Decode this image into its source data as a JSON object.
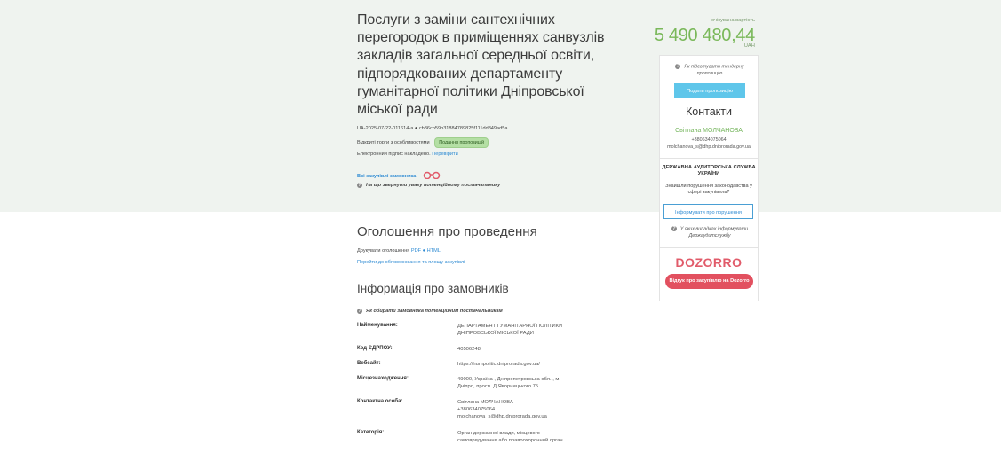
{
  "tender": {
    "title": "Послуги з заміни сантехнічних перегородок в приміщеннях санвузлів закладів загальної середньої освіти, підпорядкованих департаменту гуманітарної політики Дніпровської міської ради",
    "id_line": "UA-2025-07-22-011614-a ● cb86cb59b31884789825f111dd849ad5a",
    "status_prefix": "Відкриті торги з особливостями",
    "status_badge": "Подання пропозицій",
    "signature_text": "Електронний підпис накладено.",
    "signature_link": "Перевірити",
    "buyer_purchases_link": "Всі закупівлі замовника",
    "hint_attention": "На що звернути увагу потенційному постачальнику"
  },
  "sidebar": {
    "amount_label": "очікувана вартість",
    "amount": "5 490 480,44",
    "currency": "UAH",
    "prepare_hint": "Як підготувати тендерну пропозицію",
    "submit_button": "Подати пропозицію",
    "contacts_title": "Контакти",
    "contact_name": "Світлана МОЛЧАНОВА",
    "contact_phone": "+380634075064",
    "contact_email": "molchanova_s@dhp.dniprorada.gov.ua",
    "audit_title": "ДЕРЖАВНА АУДИТОРСЬКА СЛУЖБА УКРАЇНИ",
    "audit_text": "Знайшли порушення законодавства у сфері закупівель?",
    "report_button": "Інформувати про порушення",
    "audit_hint": "У яких випадках інформувати Держаудитслужбу",
    "dozorro_logo": "DOZORRO",
    "feedback_button": "Відгук про закупівлю на Dozorro"
  },
  "announcement": {
    "title": "Оголошення про проведення",
    "print_label": "Друкувати оголошення",
    "print_pdf": "PDF",
    "print_html": "HTML",
    "discussion_link": "Перейти до обговорювання та площу закупівлі"
  },
  "customer": {
    "title": "Інформація про замовників",
    "hint": "Як обирати замовника потенційним постачальникам",
    "rows": [
      {
        "label": "Найменування:",
        "value": "ДЕПАРТАМЕНТ ГУМАНІТАРНОЇ ПОЛІТИКИ ДНІПРОВСЬКОЇ МІСЬКОЇ РАДИ",
        "is_link": false
      },
      {
        "label": "Код ЄДРПОУ:",
        "value": "40506248",
        "is_link": false
      },
      {
        "label": "Вебсайт:",
        "value": "https://humpolitic.dniprorada.gov.ua/",
        "is_link": true
      },
      {
        "label": "Місцезнаходження:",
        "value": "49000, Україна , Дніпропетровська обл. , м. Дніпро, просп. Д.Яворницького 75",
        "is_link": false
      },
      {
        "label": "Контактна особа:",
        "value": "Світлана МОЛЧАНОВА",
        "value2": "+380634075064",
        "value3": "molchanova_s@dhp.dniprorada.gov.ua",
        "is_link": false
      },
      {
        "label": "Категорія:",
        "value": "Орган державної влади, місцевого самоврядування або правоохоронний орган",
        "is_link": false
      }
    ]
  },
  "colors": {
    "hero_bg": "#eff3ef",
    "accent_green": "#7ab85a",
    "link_blue": "#2f8bd3",
    "submit_blue": "#5fc6ea",
    "dozorro_red": "#e2505f"
  }
}
